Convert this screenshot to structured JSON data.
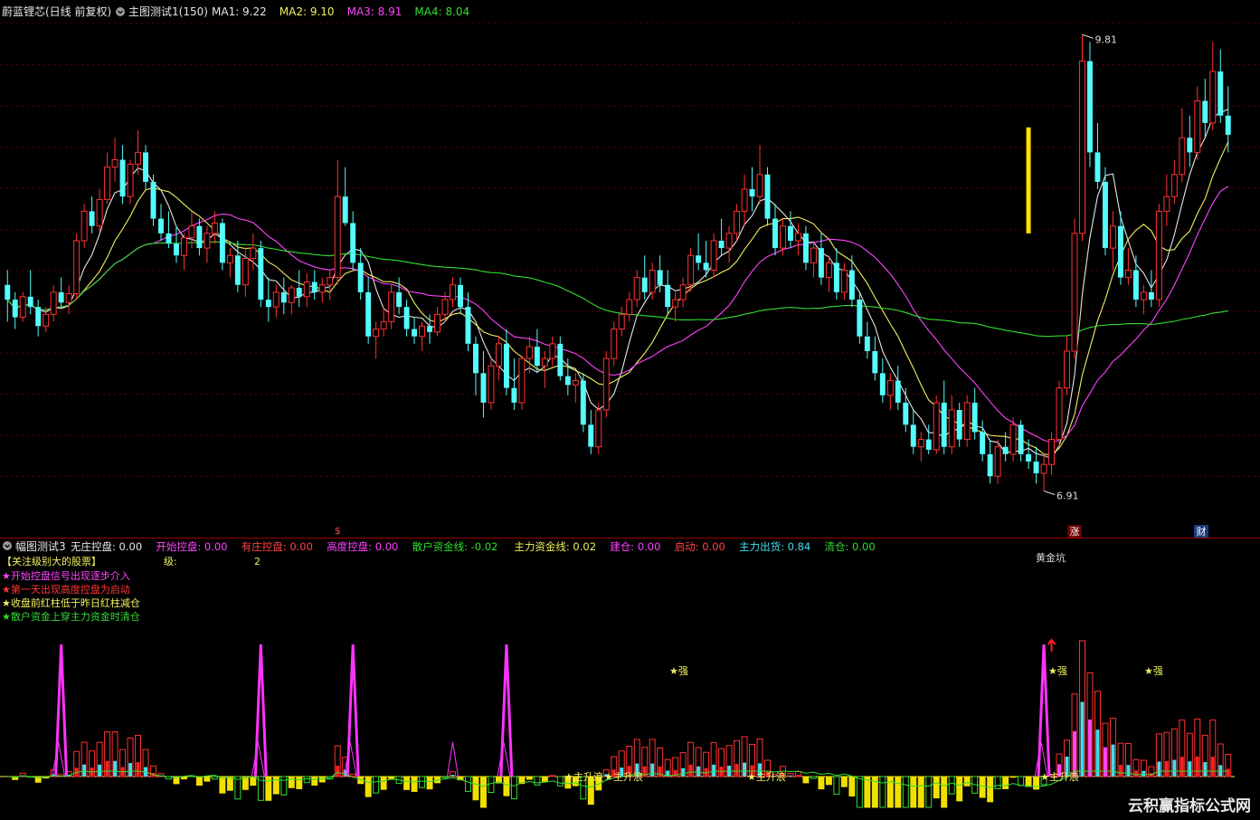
{
  "main_header": {
    "stock": "蔚蓝锂芯(日线 前复权)",
    "indicator": "主图测试1(150)",
    "ma": [
      {
        "label": "MA1: 9.22",
        "color": "#e6e6e6"
      },
      {
        "label": "MA2: 9.10",
        "color": "#f0f060"
      },
      {
        "label": "MA3: 8.91",
        "color": "#ff44ff"
      },
      {
        "label": "MA4: 8.04",
        "color": "#33dd33"
      }
    ]
  },
  "sub_header": {
    "indicator": "幅图测试3",
    "items": [
      {
        "label": "无庄控盘: 0.00",
        "color": "#e6e6e6"
      },
      {
        "label": "开始控盘: 0.00",
        "color": "#ff44ff"
      },
      {
        "label": "有庄控盘: 0.00",
        "color": "#ff4444"
      },
      {
        "label": "高度控盘: 0.00",
        "color": "#ff44ff"
      },
      {
        "label": "散户资金线: -0.02",
        "color": "#33dd33"
      },
      {
        "label": "主力资金线: 0.02",
        "color": "#f0f060"
      },
      {
        "label": "建仓: 0.00",
        "color": "#ff44ff"
      },
      {
        "label": "启动: 0.00",
        "color": "#ff4444"
      },
      {
        "label": "主力出货: 0.84",
        "color": "#44ddee"
      },
      {
        "label": "清仓: 0.00",
        "color": "#33dd33"
      }
    ]
  },
  "notes": {
    "title": "【关注级别大的股票】",
    "level_label": "级:",
    "level_value": "2",
    "lines": [
      {
        "text": "★开始控盘信号出现逐步介入",
        "color": "#ff44ff"
      },
      {
        "text": "★第一天出现高度控盘为启动",
        "color": "#ff3333"
      },
      {
        "text": "★收盘前红柱低于昨日红柱减仓",
        "color": "#f0f060"
      },
      {
        "text": "★散户资金上穿主力资金时清仓",
        "color": "#33dd33"
      }
    ]
  },
  "watermark": "云积赢指标公式网",
  "colors": {
    "up": "#ff3232",
    "down": "#54fcfc",
    "grid": "#7a0000"
  },
  "chart_data": {
    "type": "candlestick",
    "ylim": [
      6.6,
      10.0
    ],
    "annotations": {
      "high": "9.81",
      "low": "6.91",
      "markers": [
        "$",
        "涨",
        "财"
      ],
      "sub_labels": [
        "★强",
        "★强",
        "★强",
        "★主升浪",
        "★主升浪",
        "★主升浪",
        "★主升浪",
        "黄金坑"
      ]
    },
    "ohlc": [
      [
        8.2,
        8.3,
        7.95,
        8.1
      ],
      [
        8.1,
        8.15,
        7.9,
        7.98
      ],
      [
        7.98,
        8.15,
        7.95,
        8.12
      ],
      [
        8.12,
        8.3,
        8.0,
        8.05
      ],
      [
        8.05,
        8.1,
        7.85,
        7.92
      ],
      [
        7.92,
        8.05,
        7.88,
        8.0
      ],
      [
        8.0,
        8.2,
        7.95,
        8.15
      ],
      [
        8.15,
        8.25,
        8.05,
        8.08
      ],
      [
        8.08,
        8.2,
        8.0,
        8.14
      ],
      [
        8.14,
        8.55,
        8.1,
        8.5
      ],
      [
        8.5,
        8.75,
        8.45,
        8.7
      ],
      [
        8.7,
        8.8,
        8.55,
        8.6
      ],
      [
        8.6,
        8.85,
        8.55,
        8.78
      ],
      [
        8.78,
        9.1,
        8.75,
        9.0
      ],
      [
        9.0,
        9.2,
        8.9,
        9.05
      ],
      [
        9.05,
        9.15,
        8.75,
        8.8
      ],
      [
        8.8,
        9.05,
        8.75,
        9.02
      ],
      [
        9.02,
        9.25,
        8.95,
        9.1
      ],
      [
        9.1,
        9.15,
        8.85,
        8.9
      ],
      [
        8.9,
        8.95,
        8.6,
        8.65
      ],
      [
        8.65,
        8.75,
        8.5,
        8.55
      ],
      [
        8.55,
        8.7,
        8.45,
        8.48
      ],
      [
        8.48,
        8.6,
        8.35,
        8.4
      ],
      [
        8.4,
        8.55,
        8.3,
        8.52
      ],
      [
        8.52,
        8.7,
        8.45,
        8.6
      ],
      [
        8.6,
        8.65,
        8.4,
        8.45
      ],
      [
        8.45,
        8.6,
        8.35,
        8.55
      ],
      [
        8.55,
        8.7,
        8.48,
        8.62
      ],
      [
        8.62,
        8.65,
        8.3,
        8.35
      ],
      [
        8.35,
        8.45,
        8.25,
        8.4
      ],
      [
        8.4,
        8.5,
        8.15,
        8.2
      ],
      [
        8.2,
        8.45,
        8.12,
        8.38
      ],
      [
        8.38,
        8.55,
        8.3,
        8.45
      ],
      [
        8.45,
        8.5,
        8.05,
        8.1
      ],
      [
        8.1,
        8.25,
        7.95,
        8.05
      ],
      [
        8.05,
        8.2,
        7.98,
        8.15
      ],
      [
        8.15,
        8.25,
        8.0,
        8.08
      ],
      [
        8.08,
        8.2,
        8.0,
        8.18
      ],
      [
        8.18,
        8.3,
        8.05,
        8.12
      ],
      [
        8.12,
        8.28,
        8.05,
        8.22
      ],
      [
        8.22,
        8.3,
        8.1,
        8.15
      ],
      [
        8.15,
        8.25,
        8.08,
        8.2
      ],
      [
        8.2,
        8.3,
        8.1,
        8.25
      ],
      [
        8.25,
        9.05,
        8.2,
        8.8
      ],
      [
        8.8,
        9.0,
        8.6,
        8.62
      ],
      [
        8.62,
        8.7,
        8.3,
        8.35
      ],
      [
        8.35,
        8.45,
        8.1,
        8.15
      ],
      [
        8.15,
        8.25,
        7.8,
        7.85
      ],
      [
        7.85,
        7.95,
        7.7,
        7.9
      ],
      [
        7.9,
        8.05,
        7.85,
        7.95
      ],
      [
        7.95,
        8.2,
        7.9,
        8.15
      ],
      [
        8.15,
        8.25,
        8.0,
        8.05
      ],
      [
        8.05,
        8.1,
        7.85,
        7.9
      ],
      [
        7.9,
        7.98,
        7.8,
        7.85
      ],
      [
        7.85,
        7.95,
        7.75,
        7.92
      ],
      [
        7.92,
        8.0,
        7.8,
        7.88
      ],
      [
        7.88,
        8.05,
        7.85,
        8.0
      ],
      [
        8.0,
        8.15,
        7.95,
        8.1
      ],
      [
        8.1,
        8.25,
        8.05,
        8.2
      ],
      [
        8.2,
        8.25,
        8.0,
        8.05
      ],
      [
        8.05,
        8.15,
        7.75,
        7.8
      ],
      [
        7.8,
        7.85,
        7.45,
        7.6
      ],
      [
        7.6,
        7.75,
        7.3,
        7.4
      ],
      [
        7.4,
        7.7,
        7.35,
        7.65
      ],
      [
        7.65,
        7.85,
        7.55,
        7.8
      ],
      [
        7.8,
        7.9,
        7.45,
        7.5
      ],
      [
        7.5,
        7.7,
        7.35,
        7.4
      ],
      [
        7.4,
        7.72,
        7.35,
        7.7
      ],
      [
        7.7,
        7.85,
        7.6,
        7.78
      ],
      [
        7.78,
        7.9,
        7.6,
        7.65
      ],
      [
        7.65,
        7.75,
        7.5,
        7.7
      ],
      [
        7.7,
        7.85,
        7.65,
        7.8
      ],
      [
        7.8,
        7.85,
        7.55,
        7.58
      ],
      [
        7.58,
        7.7,
        7.45,
        7.52
      ],
      [
        7.52,
        7.6,
        7.4,
        7.55
      ],
      [
        7.55,
        7.6,
        7.2,
        7.25
      ],
      [
        7.25,
        7.35,
        7.05,
        7.1
      ],
      [
        7.1,
        7.4,
        7.05,
        7.35
      ],
      [
        7.35,
        7.75,
        7.3,
        7.7
      ],
      [
        7.7,
        7.95,
        7.65,
        7.9
      ],
      [
        7.9,
        8.05,
        7.85,
        8.0
      ],
      [
        8.0,
        8.15,
        7.95,
        8.1
      ],
      [
        8.1,
        8.3,
        8.05,
        8.25
      ],
      [
        8.25,
        8.4,
        8.1,
        8.15
      ],
      [
        8.15,
        8.35,
        8.1,
        8.3
      ],
      [
        8.3,
        8.4,
        8.15,
        8.2
      ],
      [
        8.2,
        8.3,
        8.0,
        8.05
      ],
      [
        8.05,
        8.15,
        7.95,
        8.1
      ],
      [
        8.1,
        8.25,
        8.05,
        8.2
      ],
      [
        8.2,
        8.45,
        8.15,
        8.4
      ],
      [
        8.4,
        8.55,
        8.3,
        8.35
      ],
      [
        8.35,
        8.5,
        8.25,
        8.3
      ],
      [
        8.3,
        8.55,
        8.25,
        8.5
      ],
      [
        8.5,
        8.65,
        8.4,
        8.45
      ],
      [
        8.45,
        8.6,
        8.35,
        8.55
      ],
      [
        8.55,
        8.75,
        8.5,
        8.7
      ],
      [
        8.7,
        8.95,
        8.6,
        8.85
      ],
      [
        8.85,
        9.0,
        8.7,
        8.8
      ],
      [
        8.8,
        9.15,
        8.75,
        8.95
      ],
      [
        8.95,
        9.0,
        8.6,
        8.65
      ],
      [
        8.65,
        8.75,
        8.4,
        8.45
      ],
      [
        8.45,
        8.65,
        8.4,
        8.6
      ],
      [
        8.6,
        8.7,
        8.45,
        8.5
      ],
      [
        8.5,
        8.62,
        8.4,
        8.55
      ],
      [
        8.55,
        8.6,
        8.3,
        8.35
      ],
      [
        8.35,
        8.5,
        8.25,
        8.45
      ],
      [
        8.45,
        8.55,
        8.2,
        8.25
      ],
      [
        8.25,
        8.4,
        8.15,
        8.35
      ],
      [
        8.35,
        8.45,
        8.1,
        8.15
      ],
      [
        8.15,
        8.35,
        8.1,
        8.3
      ],
      [
        8.3,
        8.4,
        8.05,
        8.1
      ],
      [
        8.1,
        8.15,
        7.8,
        7.85
      ],
      [
        7.85,
        7.95,
        7.7,
        7.75
      ],
      [
        7.75,
        7.85,
        7.55,
        7.6
      ],
      [
        7.6,
        7.7,
        7.4,
        7.45
      ],
      [
        7.45,
        7.6,
        7.35,
        7.55
      ],
      [
        7.55,
        7.65,
        7.35,
        7.4
      ],
      [
        7.4,
        7.5,
        7.2,
        7.25
      ],
      [
        7.25,
        7.35,
        7.05,
        7.1
      ],
      [
        7.1,
        7.2,
        7.0,
        7.15
      ],
      [
        7.15,
        7.25,
        7.05,
        7.08
      ],
      [
        7.08,
        7.45,
        7.05,
        7.4
      ],
      [
        7.4,
        7.55,
        7.05,
        7.1
      ],
      [
        7.1,
        7.45,
        7.05,
        7.35
      ],
      [
        7.35,
        7.4,
        7.1,
        7.15
      ],
      [
        7.15,
        7.45,
        7.1,
        7.4
      ],
      [
        7.4,
        7.5,
        7.15,
        7.2
      ],
      [
        7.2,
        7.28,
        7.0,
        7.05
      ],
      [
        7.05,
        7.15,
        6.85,
        6.9
      ],
      [
        6.9,
        7.15,
        6.85,
        7.1
      ],
      [
        7.1,
        7.2,
        7.0,
        7.05
      ],
      [
        7.05,
        7.3,
        7.0,
        7.25
      ],
      [
        7.25,
        7.28,
        7.0,
        7.05
      ],
      [
        7.05,
        7.15,
        6.95,
        7.0
      ],
      [
        7.0,
        7.1,
        6.85,
        6.92
      ],
      [
        6.92,
        7.05,
        6.8,
        6.98
      ],
      [
        6.98,
        7.2,
        6.91,
        7.15
      ],
      [
        7.15,
        7.55,
        7.1,
        7.5
      ],
      [
        7.5,
        7.85,
        7.45,
        7.75
      ],
      [
        7.75,
        8.65,
        7.7,
        8.55
      ],
      [
        8.55,
        9.9,
        8.5,
        9.72
      ],
      [
        9.72,
        9.85,
        9.0,
        9.1
      ],
      [
        9.1,
        9.3,
        8.85,
        8.9
      ],
      [
        8.9,
        9.0,
        8.4,
        8.45
      ],
      [
        8.45,
        8.7,
        8.3,
        8.6
      ],
      [
        8.6,
        8.7,
        8.2,
        8.25
      ],
      [
        8.25,
        8.45,
        8.2,
        8.3
      ],
      [
        8.3,
        8.4,
        8.05,
        8.1
      ],
      [
        8.1,
        8.2,
        8.0,
        8.15
      ],
      [
        8.15,
        8.3,
        8.05,
        8.1
      ],
      [
        8.1,
        8.75,
        8.05,
        8.7
      ],
      [
        8.7,
        8.95,
        8.6,
        8.8
      ],
      [
        8.8,
        9.05,
        8.75,
        8.95
      ],
      [
        8.95,
        9.4,
        8.9,
        9.2
      ],
      [
        9.2,
        9.35,
        9.0,
        9.1
      ],
      [
        9.1,
        9.55,
        9.05,
        9.45
      ],
      [
        9.45,
        9.6,
        9.2,
        9.3
      ],
      [
        9.3,
        9.85,
        9.25,
        9.65
      ],
      [
        9.65,
        9.8,
        9.3,
        9.35
      ],
      [
        9.35,
        9.55,
        9.1,
        9.22
      ]
    ]
  }
}
